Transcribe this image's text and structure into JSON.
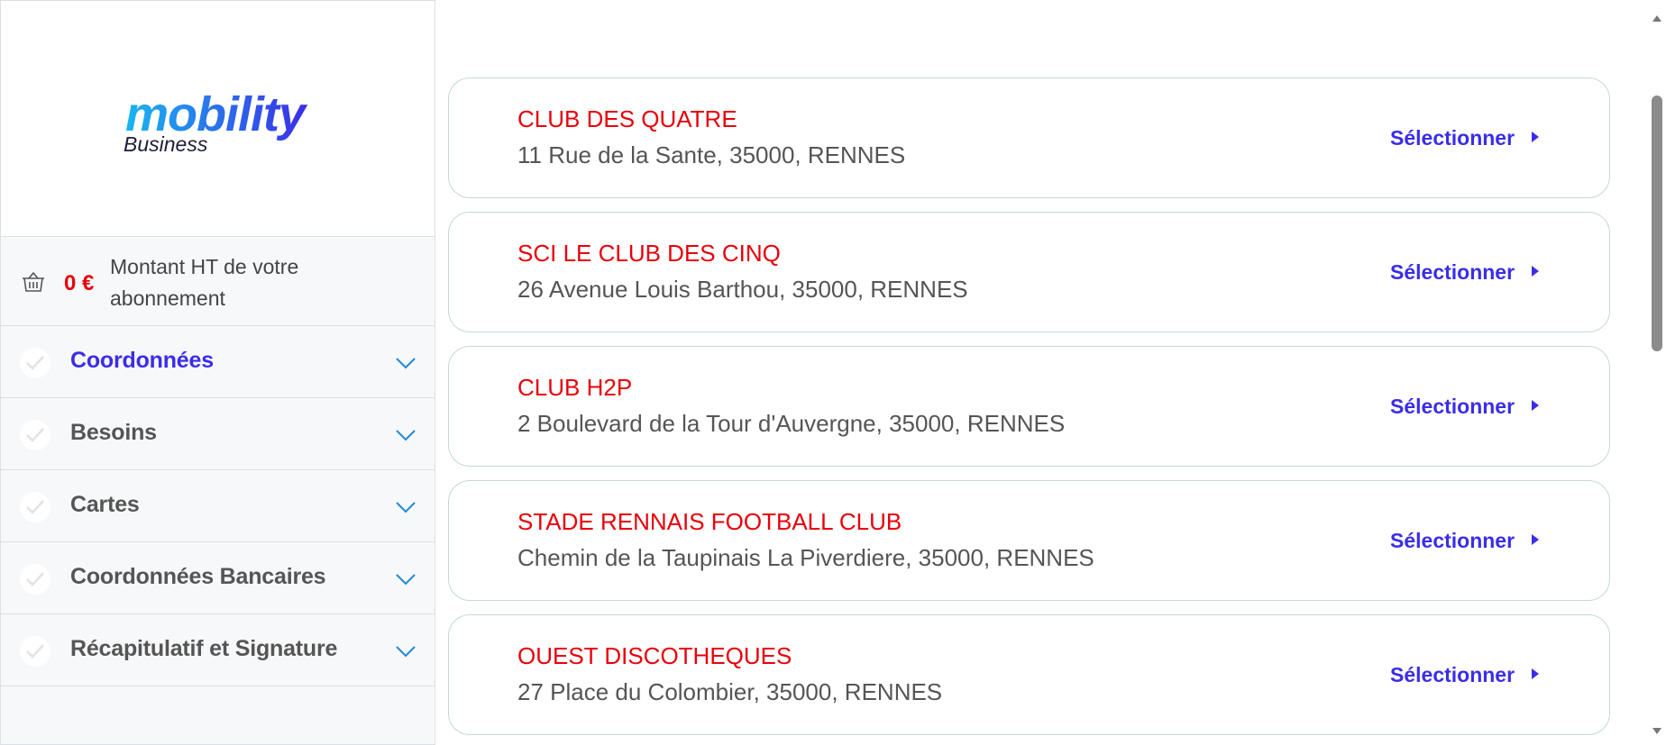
{
  "brand": {
    "logo_main": "mobility",
    "logo_sub": "Business",
    "accent_color": "#3b2de8",
    "highlight_color": "#e8000b"
  },
  "summary": {
    "amount": "0 €",
    "label": "Montant HT de votre abonnement"
  },
  "steps": [
    {
      "label": "Coordonnées",
      "active": true
    },
    {
      "label": "Besoins",
      "active": false
    },
    {
      "label": "Cartes",
      "active": false
    },
    {
      "label": "Coordonnées Bancaires",
      "active": false
    },
    {
      "label": "Récapitulatif et Signature",
      "active": false
    }
  ],
  "select_label": "Sélectionner",
  "results": [
    {
      "name": "CLUB DES QUATRE",
      "address": "11 Rue de la Sante, 35000, RENNES"
    },
    {
      "name": "SCI LE CLUB DES CINQ",
      "address": "26 Avenue Louis Barthou, 35000, RENNES"
    },
    {
      "name": "CLUB H2P",
      "address": "2 Boulevard de la Tour d'Auvergne, 35000, RENNES"
    },
    {
      "name": "STADE RENNAIS FOOTBALL CLUB",
      "address": "Chemin de la Taupinais La Piverdiere, 35000, RENNES"
    },
    {
      "name": "OUEST DISCOTHEQUES",
      "address": "27 Place du Colombier, 35000, RENNES"
    }
  ]
}
